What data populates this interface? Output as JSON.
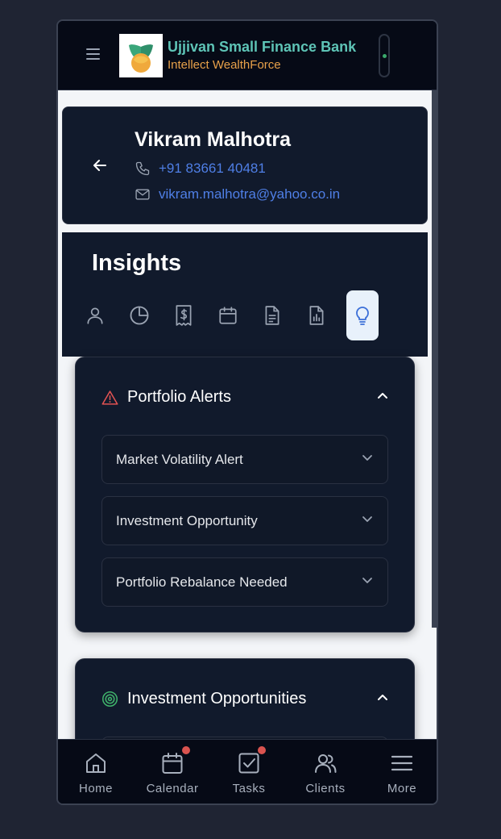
{
  "header": {
    "brand_title": "Ujjivan Small Finance Bank",
    "brand_subtitle": "Intellect WealthForce",
    "menu_icon": "hamburger-icon",
    "colors": {
      "title": "#5ec4b6",
      "subtitle": "#e8a14a"
    }
  },
  "client": {
    "name": "Vikram Malhotra",
    "phone": "+91 83661 40481",
    "email": "vikram.malhotra@yahoo.co.in"
  },
  "insights": {
    "title": "Insights",
    "tabs": [
      {
        "icon": "user-icon",
        "active": false
      },
      {
        "icon": "pie-chart-icon",
        "active": false
      },
      {
        "icon": "receipt-dollar-icon",
        "active": false
      },
      {
        "icon": "calendar-icon",
        "active": false
      },
      {
        "icon": "document-icon",
        "active": false
      },
      {
        "icon": "report-chart-icon",
        "active": false
      },
      {
        "icon": "lightbulb-icon",
        "active": true
      }
    ]
  },
  "sections": {
    "portfolio_alerts": {
      "title": "Portfolio Alerts",
      "icon": "warning-triangle-icon",
      "expanded": true,
      "items": [
        {
          "label": "Market Volatility Alert"
        },
        {
          "label": "Investment Opportunity"
        },
        {
          "label": "Portfolio Rebalance Needed"
        }
      ]
    },
    "investment_opportunities": {
      "title": "Investment Opportunities",
      "icon": "target-icon",
      "expanded": true
    }
  },
  "bottom_nav": [
    {
      "label": "Home",
      "icon": "home-icon",
      "badge": false
    },
    {
      "label": "Calendar",
      "icon": "calendar-icon",
      "badge": true
    },
    {
      "label": "Tasks",
      "icon": "task-check-icon",
      "badge": true
    },
    {
      "label": "Clients",
      "icon": "users-icon",
      "badge": false
    },
    {
      "label": "More",
      "icon": "menu-icon",
      "badge": false
    }
  ],
  "colors": {
    "accent": "#4f7fe6",
    "alert": "#e05252",
    "target": "#3fb06a",
    "badge": "#d9534f"
  }
}
